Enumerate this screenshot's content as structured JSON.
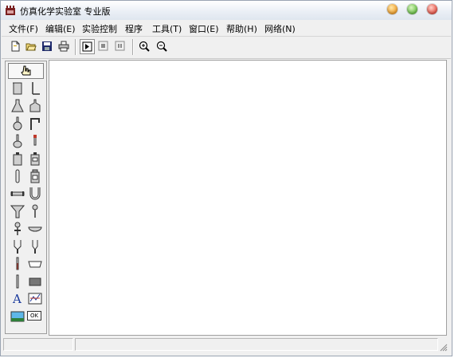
{
  "window": {
    "title": "仿真化学实验室 专业版"
  },
  "menu": {
    "items": [
      {
        "label": "文件(F)"
      },
      {
        "label": "编辑(E)"
      },
      {
        "label": "实验控制"
      },
      {
        "label": "程序"
      },
      {
        "label": "工具(T)"
      },
      {
        "label": "窗口(E)"
      },
      {
        "label": "帮助(H)"
      },
      {
        "label": "网络(N)"
      }
    ]
  },
  "toolbar": {
    "buttons": [
      {
        "icon": "new-document-icon"
      },
      {
        "icon": "open-folder-icon"
      },
      {
        "icon": "save-disk-icon"
      },
      {
        "icon": "print-icon"
      },
      {
        "icon": "play-icon"
      },
      {
        "icon": "stop-icon"
      },
      {
        "icon": "pause-icon"
      },
      {
        "icon": "zoom-in-icon"
      },
      {
        "icon": "zoom-out-icon"
      }
    ]
  },
  "palette": {
    "text_tool_label": "A",
    "ok_button_label": "OK",
    "items": [
      "beaker-icon",
      "iron-stand-icon",
      "conical-flask-icon",
      "gas-bottle-icon",
      "round-flask-icon",
      "bent-tube-icon",
      "flat-flask-icon",
      "dropper-icon",
      "reagent-bottle-icon",
      "wash-bottle-icon",
      "test-tube-icon",
      "gas-jar-icon",
      "horizontal-tube-icon",
      "u-tube-icon",
      "funnel-icon",
      "spoon-icon",
      "separatory-funnel-icon",
      "evaporating-dish-icon",
      "burette-icon",
      "burette-2-icon",
      "thermometer-icon",
      "glass-plate-icon",
      "glass-rod-icon",
      "block-icon",
      "chart-tool-icon",
      "image-tool-icon"
    ]
  },
  "colors": {
    "accent_blue": "#1a3a9c",
    "canvas_bg": "#ffffff",
    "chrome_bg": "#f0f0f0"
  }
}
